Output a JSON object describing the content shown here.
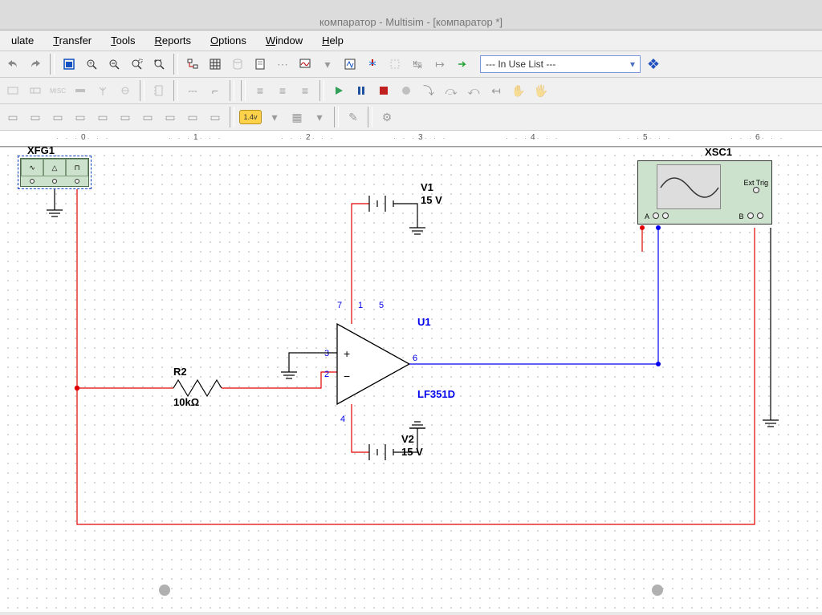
{
  "title": "компаратор - Multisim - [компаратор *]",
  "menu": {
    "items": [
      "ulate",
      "Transfer",
      "Tools",
      "Reports",
      "Options",
      "Window",
      "Help"
    ]
  },
  "toolbar1": {
    "in_use_list": "--- In Use List ---"
  },
  "toolbar3": {
    "badge": "1.4v"
  },
  "ruler": {
    "marks": [
      "0",
      "1",
      "2",
      "3",
      "4",
      "5",
      "6"
    ]
  },
  "circuit": {
    "xfg": {
      "name": "XFG1"
    },
    "xsc": {
      "name": "XSC1",
      "ext_trig": "Ext Trig",
      "ch_a": "A",
      "ch_b": "B"
    },
    "v1": {
      "name": "V1",
      "value": "15 V"
    },
    "v2": {
      "name": "V2",
      "value": "15 V"
    },
    "r2": {
      "name": "R2",
      "value": "10kΩ"
    },
    "u1": {
      "name": "U1",
      "part": "LF351D",
      "pins": {
        "p1": "1",
        "p2": "2",
        "p3": "3",
        "p4": "4",
        "p5": "5",
        "p6": "6",
        "p7": "7",
        "plus": "+",
        "minus": "−"
      }
    }
  }
}
